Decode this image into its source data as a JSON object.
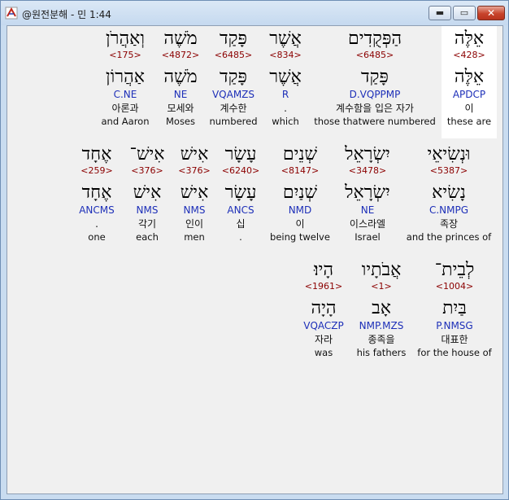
{
  "window": {
    "title": "@원전분해 - 민 1:44",
    "close_glyph": "✕",
    "min_glyph": "▬",
    "max_glyph": "▭"
  },
  "colors": {
    "strong": "#8b0000",
    "morph": "#1d2fb8",
    "highlight": "#ffffff"
  },
  "rows": [
    [
      {
        "heb": "אֵלֶּה",
        "strong": "<428>",
        "lemma": "אֵלֶּה",
        "morph": "APDCP",
        "kor": "이",
        "eng": "these are"
      },
      {
        "heb": "הַפְּקֻדִים",
        "strong": "<6485>",
        "lemma": "פָּקַד",
        "morph": "D.VQPPMP",
        "kor": "계수함을 입은 자가",
        "eng": "those thatwere numbered"
      },
      {
        "heb": "אֲשֶׁר",
        "strong": "<834>",
        "lemma": "אֲשֶׁר",
        "morph": "R",
        "kor": ".",
        "eng": "which"
      },
      {
        "heb": "פָּקַד",
        "strong": "<6485>",
        "lemma": "פָּקַד",
        "morph": "VQAMZS",
        "kor": "계수한",
        "eng": "numbered"
      },
      {
        "heb": "מֹשֶׁה",
        "strong": "<4872>",
        "lemma": "מֹשֶׁה",
        "morph": "NE",
        "kor": "모세와",
        "eng": "Moses"
      },
      {
        "heb": "וְאַהֲרֹן",
        "strong": "<175>",
        "lemma": "אַהֲרוֹן",
        "morph": "C.NE",
        "kor": "아론과",
        "eng": "and Aaron"
      }
    ],
    [
      {
        "heb": "וּנְשִׂיאֵי",
        "strong": "<5387>",
        "lemma": "נָשִׂיא",
        "morph": "C.NMPG",
        "kor": "족장",
        "eng": "and the princes of"
      },
      {
        "heb": "יִשְׂרָאֵל",
        "strong": "<3478>",
        "lemma": "יִשְׂרָאֵל",
        "morph": "NE",
        "kor": "이스라엘",
        "eng": "Israel"
      },
      {
        "heb": "שְׁנֵים",
        "strong": "<8147>",
        "lemma": "שְׁנַיִם",
        "morph": "NMD",
        "kor": "이",
        "eng": "being twelve"
      },
      {
        "heb": "עָשָׂר",
        "strong": "<6240>",
        "lemma": "עָשָׂר",
        "morph": "ANCS",
        "kor": "십",
        "eng": "."
      },
      {
        "heb": "אִישׁ",
        "strong": "<376>",
        "lemma": "אִישׁ",
        "morph": "NMS",
        "kor": "인이",
        "eng": "men"
      },
      {
        "heb": "אִישׁ־",
        "strong": "<376>",
        "lemma": "אִישׁ",
        "morph": "NMS",
        "kor": "각기",
        "eng": "each"
      },
      {
        "heb": "אֶחָד",
        "strong": "<259>",
        "lemma": "אֶחָד",
        "morph": "ANCMS",
        "kor": ".",
        "eng": "one"
      }
    ],
    [
      {
        "heb": "לְבֵית־",
        "strong": "<1004>",
        "lemma": "בַּיִת",
        "morph": "P.NMSG",
        "kor": "대표한",
        "eng": "for the house of"
      },
      {
        "heb": "אֲבֹתָיו",
        "strong": "<1>",
        "lemma": "אָב",
        "morph": "NMP.MZS",
        "kor": "종족을",
        "eng": "his fathers"
      },
      {
        "heb": "הָיוּ׃",
        "strong": "<1961>",
        "lemma": "הָיָה",
        "morph": "VQACZP",
        "kor": "자라",
        "eng": "was"
      }
    ]
  ]
}
